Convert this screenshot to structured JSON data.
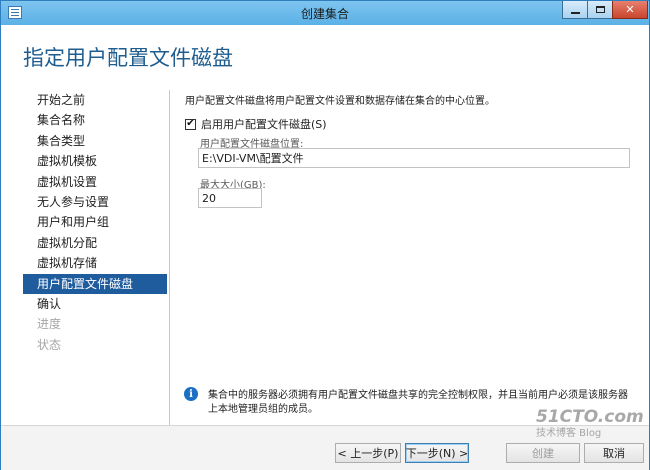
{
  "window": {
    "title": "创建集合"
  },
  "page": {
    "heading": "指定用户配置文件磁盘"
  },
  "nav": {
    "items": [
      {
        "label": "开始之前",
        "state": "normal"
      },
      {
        "label": "集合名称",
        "state": "normal"
      },
      {
        "label": "集合类型",
        "state": "normal"
      },
      {
        "label": "虚拟机模板",
        "state": "normal"
      },
      {
        "label": "虚拟机设置",
        "state": "normal"
      },
      {
        "label": "无人参与设置",
        "state": "normal"
      },
      {
        "label": "用户和用户组",
        "state": "normal"
      },
      {
        "label": "虚拟机分配",
        "state": "normal"
      },
      {
        "label": "虚拟机存储",
        "state": "normal"
      },
      {
        "label": "用户配置文件磁盘",
        "state": "selected"
      },
      {
        "label": "确认",
        "state": "normal"
      },
      {
        "label": "进度",
        "state": "disabled"
      },
      {
        "label": "状态",
        "state": "disabled"
      }
    ]
  },
  "content": {
    "description": "用户配置文件磁盘将用户配置文件设置和数据存储在集合的中心位置。",
    "enable_checkbox": {
      "label": "启用用户配置文件磁盘(S)",
      "checked": true,
      "mark": "✔"
    },
    "location": {
      "label": "用户配置文件磁盘位置:",
      "value": "E:\\VDI-VM\\配置文件"
    },
    "max_size": {
      "label": "最大大小(GB):",
      "value": "20"
    },
    "info": {
      "icon": "info-icon",
      "text": "集合中的服务器必须拥有用户配置文件磁盘共享的完全控制权限，并且当前用户必须是该服务器上本地管理员组的成员。"
    }
  },
  "buttons": {
    "prev": "< 上一步(P)",
    "next": "下一步(N) >",
    "create": "创建",
    "cancel": "取消"
  },
  "watermark": {
    "line1": "51CTO.com",
    "line2": "技术博客 Blog"
  },
  "colors": {
    "accent": "#1f5c9e",
    "heading": "#1f5d8f",
    "titlebar": "#5bb1e6"
  }
}
